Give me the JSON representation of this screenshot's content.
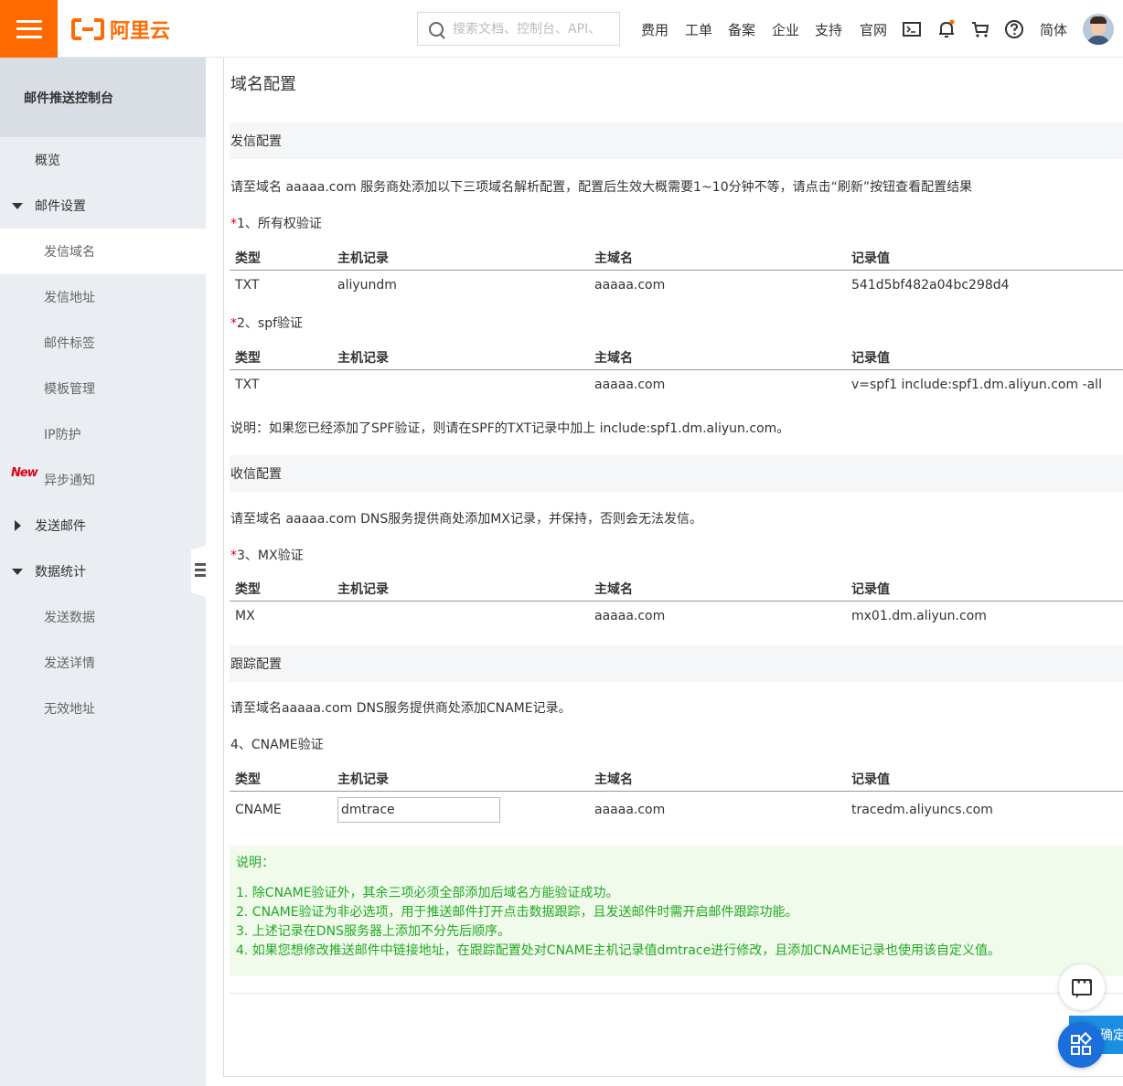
{
  "header": {
    "logo_text": "阿里云",
    "search_placeholder": "搜索文档、控制台、API、",
    "nav": [
      "费用",
      "工单",
      "备案",
      "企业",
      "支持",
      "官网"
    ],
    "lang": "简体"
  },
  "sidebar": {
    "title": "邮件推送控制台",
    "items": [
      {
        "label": "概览"
      },
      {
        "label": "邮件设置"
      },
      {
        "label": "发信域名"
      },
      {
        "label": "发信地址"
      },
      {
        "label": "邮件标签"
      },
      {
        "label": "模板管理"
      },
      {
        "label": "IP防护"
      },
      {
        "label": "异步通知",
        "badge": "New"
      },
      {
        "label": "发送邮件"
      },
      {
        "label": "数据统计"
      },
      {
        "label": "发送数据"
      },
      {
        "label": "发送详情"
      },
      {
        "label": "无效地址"
      }
    ]
  },
  "page": {
    "title": "域名配置",
    "table_headers": [
      "类型",
      "主机记录",
      "主域名",
      "记录值"
    ],
    "send_config": {
      "title": "发信配置",
      "desc": "请至域名 aaaaa.com 服务商处添加以下三项域名解析配置，配置后生效大概需要1~10分钟不等，请点击“刷新”按钮查看配置结果",
      "ownership": {
        "label": "1、所有权验证",
        "row": [
          "TXT",
          "aliyundm",
          "aaaaa.com",
          "541d5bf482a04bc298d4"
        ]
      },
      "spf": {
        "label": "2、spf验证",
        "row": [
          "TXT",
          "",
          "aaaaa.com",
          "v=spf1 include:spf1.dm.aliyun.com -all"
        ]
      },
      "note": "说明：如果您已经添加了SPF验证，则请在SPF的TXT记录中加上 include:spf1.dm.aliyun.com。"
    },
    "receive_config": {
      "title": "收信配置",
      "desc": "请至域名 aaaaa.com DNS服务提供商处添加MX记录，并保持，否则会无法发信。",
      "mx": {
        "label": "3、MX验证",
        "row": [
          "MX",
          "",
          "aaaaa.com",
          "mx01.dm.aliyun.com"
        ]
      }
    },
    "track_config": {
      "title": "跟踪配置",
      "desc": "请至域名aaaaa.com DNS服务提供商处添加CNAME记录。",
      "cname": {
        "label": "4、CNAME验证",
        "type": "CNAME",
        "host_value": "dmtrace",
        "domain": "aaaaa.com",
        "value": "tracedm.aliyuncs.com"
      }
    },
    "notes": {
      "title": "说明：",
      "items": [
        "1. 除CNAME验证外，其余三项必须全部添加后域名方能验证成功。",
        "2. CNAME验证为非必选项，用于推送邮件打开点击数据跟踪，且发送邮件时需开启邮件跟踪功能。",
        "3. 上述记录在DNS服务器上添加不分先后顺序。",
        "4. 如果您想修改推送邮件中链接地址，在跟踪配置处对CNAME主机记录值dmtrace进行修改，且添加CNAME记录也使用该自定义值。"
      ]
    },
    "confirm_label": "确定修改"
  },
  "colors": {
    "brand": "#ff6a00",
    "required": "#e0001a",
    "note_text": "#22a822",
    "note_bg": "#f0fbec",
    "primary": "#1a8fe3"
  }
}
